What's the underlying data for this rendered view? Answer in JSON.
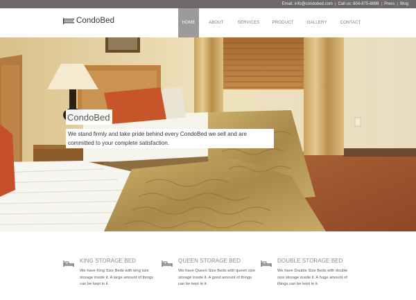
{
  "topbar": {
    "email": "Email: info@condobed.com",
    "call": "Call us: 604-875-8898",
    "press": "Press",
    "blog": "Blog"
  },
  "logo": {
    "text": "CondoBed"
  },
  "nav": [
    {
      "label": "HOME",
      "active": true
    },
    {
      "label": "ABOUT",
      "active": false
    },
    {
      "label": "SERVICES",
      "active": false
    },
    {
      "label": "PRODUCT",
      "active": false
    },
    {
      "label": "GALLERY",
      "active": false
    },
    {
      "label": "CONTACT",
      "active": false
    }
  ],
  "hero": {
    "title": "CondoBed",
    "body": "We stand firmly and take pride behind every CondoBed we sell and are committed to your complete satisfaction."
  },
  "features": [
    {
      "icon": "bed-icon",
      "title": "KING STORAGE BED",
      "text": "We have King Size Beds with king size storage inside it. A large amount of things can be kept in it."
    },
    {
      "icon": "bed-icon",
      "title": "QUEEN STORAGE BED",
      "text": "We have Queen Size Beds with queen size storage inside it. A good amount of things can be kept in it."
    },
    {
      "icon": "bed-icon",
      "title": "DOUBLE STORAGE BED",
      "text": "We have Double Size Beds with double size storage inside it. A huge amount of things can be kept in it."
    }
  ],
  "colors": {
    "topbar": "#6e6a6b",
    "nav_active": "#9c9a9b",
    "wall": "#e8d7a8",
    "bedspread": "#b89a55",
    "carpet": "#a0522d"
  }
}
